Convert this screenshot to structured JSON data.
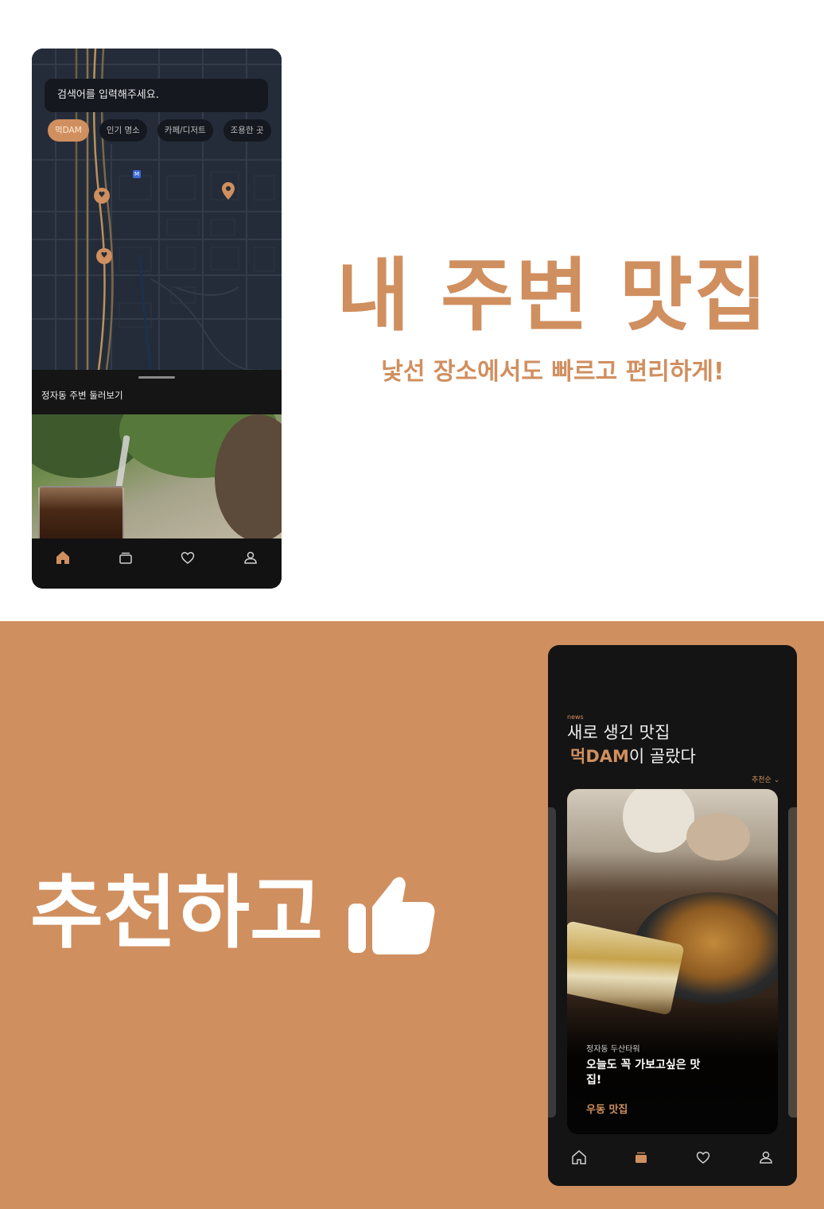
{
  "colors": {
    "accent": "#d08f5f",
    "dark": "#141414",
    "map_bg": "#252c39",
    "white": "#ffffff"
  },
  "map_screen": {
    "search_placeholder": "검색어를 입력해주세요.",
    "chips": [
      {
        "label": "먹DAM",
        "active": true
      },
      {
        "label": "인기 명소",
        "active": false
      },
      {
        "label": "카페/디저트",
        "active": false
      },
      {
        "label": "조용한 곳",
        "active": false
      }
    ],
    "metro_label": "M",
    "sheet_title": "정자동 주변 둘러보기",
    "nav": [
      {
        "icon": "home-icon",
        "active": true
      },
      {
        "icon": "box-icon",
        "active": false
      },
      {
        "icon": "heart-icon",
        "active": false
      },
      {
        "icon": "user-icon",
        "active": false
      }
    ]
  },
  "hero": {
    "headline": "내 주변 맛집",
    "subheadline": "낯선 장소에서도 빠르고 편리하게!",
    "recommend": "추천하고",
    "recommend_icon": "thumbs-up-icon"
  },
  "feed_screen": {
    "eyebrow": "news",
    "title_line1": "새로 생긴 맛집",
    "title_brand": "먹DAM",
    "title_line2_rest": "이 골랐다",
    "sort_label": "추천순 ⌄",
    "card": {
      "location": "정자동 두산타워",
      "headline": "오늘도 꼭 가보고싶은 맛집!",
      "tag": "우동 맛집"
    },
    "nav": [
      {
        "icon": "home-icon",
        "active": false
      },
      {
        "icon": "box-icon",
        "active": true
      },
      {
        "icon": "heart-icon",
        "active": false
      },
      {
        "icon": "user-icon",
        "active": false
      }
    ]
  }
}
